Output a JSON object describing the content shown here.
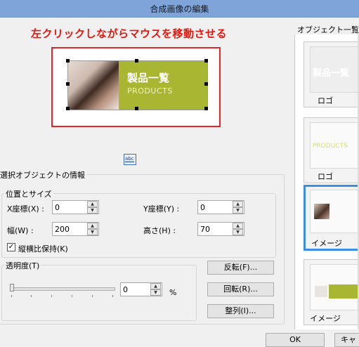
{
  "window": {
    "title": "合成画像の編集"
  },
  "instruction": "左クリックしながらマウスを移動させる",
  "banner": {
    "jp_text": "製品一覧",
    "en_text": "PRODUCTS"
  },
  "text_tool_icon": "abc",
  "selection_info": {
    "group_label": "選択オブジェクトの情報",
    "position_size": {
      "group_label": "位置とサイズ",
      "x_label": "X座標(X) :",
      "x_value": "0",
      "y_label": "Y座標(Y) :",
      "y_value": "0",
      "width_label": "幅(W) :",
      "width_value": "200",
      "height_label": "高さ(H) :",
      "height_value": "70",
      "keep_ratio_label": "縦横比保持(K)",
      "keep_ratio_checked": true
    },
    "opacity": {
      "group_label": "透明度(T)",
      "value": "0",
      "unit": "%",
      "level": 0
    }
  },
  "buttons": {
    "flip": "反転(F)...",
    "rotate": "回転(R)...",
    "align": "整列(I)...",
    "ok": "OK",
    "cancel_partial": "キャ"
  },
  "object_list": {
    "label": "オブジェクト一覧",
    "items": [
      {
        "caption": "ロゴ",
        "preview_text": "製品一覧",
        "preview_color": "#ffffff"
      },
      {
        "caption": "ロゴ",
        "preview_text": "PRODUCTS",
        "preview_color": "#d9e27a"
      },
      {
        "caption": "イメージ",
        "selected": true
      },
      {
        "caption": "イメージ"
      }
    ]
  },
  "colors": {
    "instruction": "#e8160c",
    "banner_green": "#a9b632",
    "selection_highlight": "#3a8ee6",
    "titlebar": "#7ea4d9"
  }
}
